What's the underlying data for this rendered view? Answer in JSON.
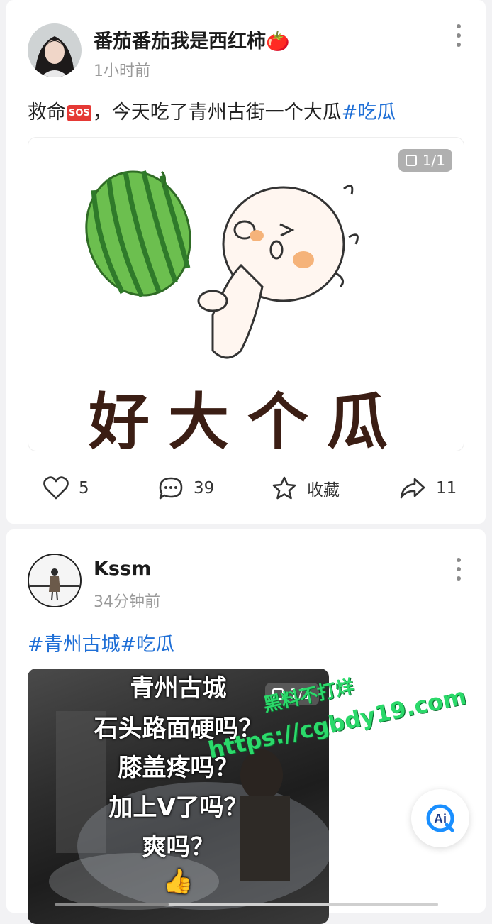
{
  "post1": {
    "username": "番茄番茄我是西红柿🍅",
    "time": "1小时前",
    "text_before": "救命",
    "sos_badge": "SOS",
    "text_after": "，今天吃了青州古街一个大瓜",
    "hashtag": "#吃瓜",
    "image_counter": "1/1",
    "image_caption": "好大个瓜",
    "actions": {
      "like_count": "5",
      "comment_count": "39",
      "collect_label": "收藏",
      "share_count": "11"
    }
  },
  "post2": {
    "username": "Kssm",
    "time": "34分钟前",
    "hashtags": "#青州古城#吃瓜",
    "video_counter": "1/1",
    "video_lines": [
      "青州古城",
      "石头路面硬吗？",
      "膝盖疼吗？",
      "加上V了吗？",
      "爽吗？",
      "👍"
    ]
  },
  "watermark": {
    "line1": "黑料不打烊",
    "line2": "https://cgbdy19.com"
  },
  "ai_button_label": "Ai",
  "colors": {
    "hashtag": "#1f6fd6",
    "watermark": "#2bd96a",
    "background": "#f2f2f4"
  }
}
